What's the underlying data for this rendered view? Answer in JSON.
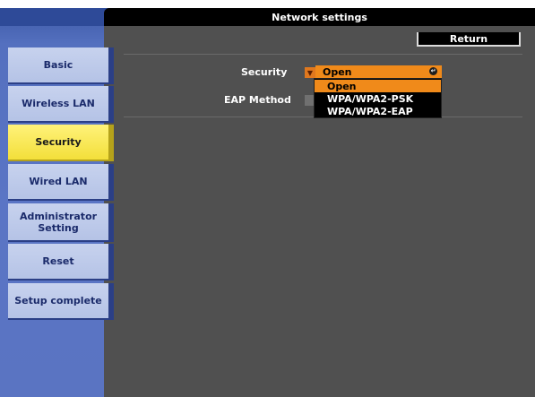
{
  "window": {
    "title": "Network settings"
  },
  "sidebar": {
    "items": [
      {
        "label": "Basic"
      },
      {
        "label": "Wireless LAN"
      },
      {
        "label": "Security"
      },
      {
        "label": "Wired LAN"
      },
      {
        "label": "Administrator Setting"
      },
      {
        "label": "Reset"
      },
      {
        "label": "Setup complete"
      }
    ],
    "active": "Security"
  },
  "header": {
    "return_label": "Return"
  },
  "form": {
    "security": {
      "label": "Security",
      "value": "Open"
    },
    "eap_method": {
      "label": "EAP Method"
    }
  },
  "dropdown": {
    "options": [
      "Open",
      "WPA/WPA2-PSK",
      "WPA/WPA2-EAP"
    ],
    "selected": "Open"
  },
  "colors": {
    "accent": "#f08a1a",
    "sidebar": "#5470bf",
    "active_tab": "#f3df3a",
    "panel": "#505050"
  }
}
